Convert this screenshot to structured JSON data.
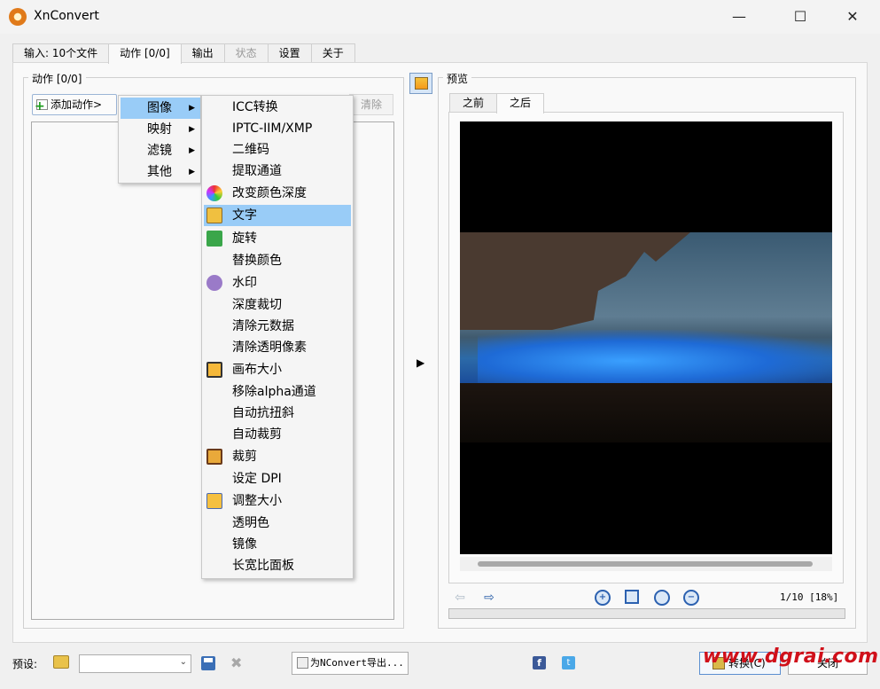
{
  "window": {
    "title": "XnConvert",
    "minimize": "—",
    "maximize": "☐",
    "close": "✕"
  },
  "tabs": [
    {
      "label": "输入: 10个文件"
    },
    {
      "label": "动作 [0/0]"
    },
    {
      "label": "输出"
    },
    {
      "label": "状态"
    },
    {
      "label": "设置"
    },
    {
      "label": "关于"
    }
  ],
  "actions": {
    "group_label": "动作 [0/0]",
    "add_button": "添加动作>",
    "clear_button": "清除"
  },
  "menu_categories": [
    {
      "label": "图像",
      "arrow": "▶"
    },
    {
      "label": "映射",
      "arrow": "▶"
    },
    {
      "label": "滤镜",
      "arrow": "▶"
    },
    {
      "label": "其他",
      "arrow": "▶"
    }
  ],
  "image_menu": [
    {
      "label": "ICC转换",
      "icon": ""
    },
    {
      "label": "IPTC-IIM/XMP",
      "icon": ""
    },
    {
      "label": "二维码",
      "icon": ""
    },
    {
      "label": "提取通道",
      "icon": ""
    },
    {
      "label": "改变颜色深度",
      "icon": "color-depth-icon"
    },
    {
      "label": "文字",
      "icon": "text-icon"
    },
    {
      "label": "旋转",
      "icon": "rotate-icon"
    },
    {
      "label": "替换颜色",
      "icon": ""
    },
    {
      "label": "水印",
      "icon": "watermark-icon"
    },
    {
      "label": "深度裁切",
      "icon": ""
    },
    {
      "label": "清除元数据",
      "icon": ""
    },
    {
      "label": "清除透明像素",
      "icon": ""
    },
    {
      "label": "画布大小",
      "icon": "canvas-icon"
    },
    {
      "label": "移除alpha通道",
      "icon": ""
    },
    {
      "label": "自动抗扭斜",
      "icon": ""
    },
    {
      "label": "自动裁剪",
      "icon": ""
    },
    {
      "label": "裁剪",
      "icon": "crop-icon"
    },
    {
      "label": "设定 DPI",
      "icon": ""
    },
    {
      "label": "调整大小",
      "icon": "resize-icon"
    },
    {
      "label": "透明色",
      "icon": ""
    },
    {
      "label": "镜像",
      "icon": ""
    },
    {
      "label": "长宽比面板",
      "icon": ""
    }
  ],
  "preview": {
    "group_label": "预览",
    "tab_before": "之前",
    "tab_after": "之后",
    "page_info": "1/10 [18%]",
    "expand_arrow": "▶"
  },
  "bottom": {
    "preset_label": "预设:",
    "preset_value": "",
    "export_button": "为NConvert导出...",
    "facebook": "f",
    "twitter": "t",
    "convert_button": "转换(C)",
    "close_button": "关闭"
  },
  "watermark": "www.dgrai.com",
  "colors": {
    "menu_highlight": "#99ccf7",
    "watermark": "#d0101a"
  }
}
